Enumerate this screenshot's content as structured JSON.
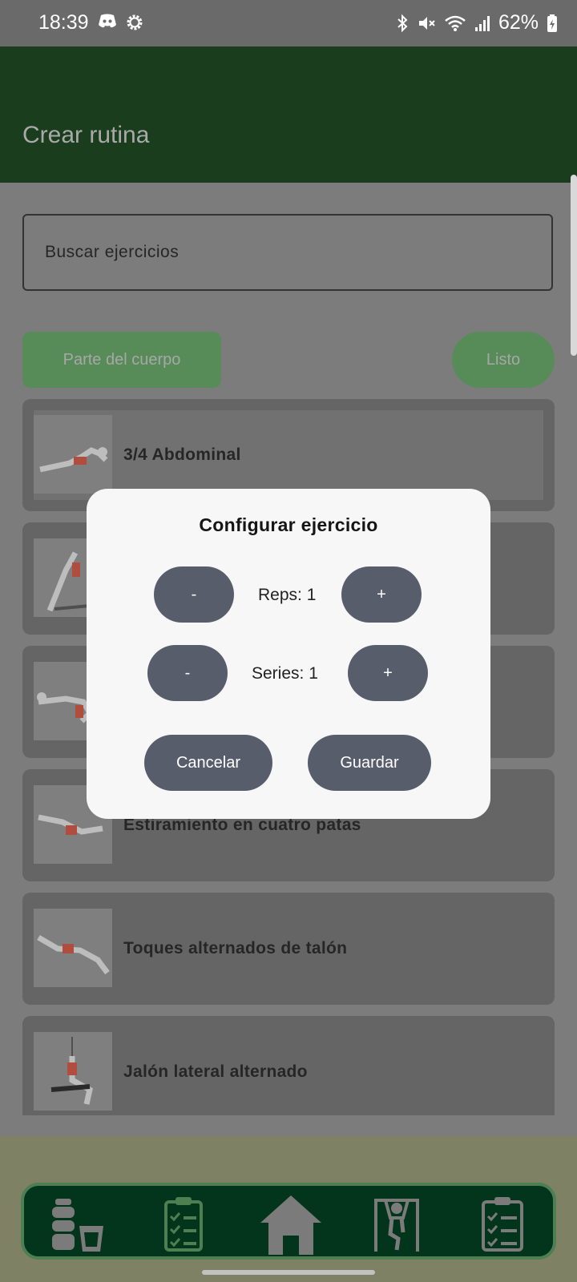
{
  "status_bar": {
    "time": "18:39",
    "battery": "62%",
    "icons_left": [
      "discord-icon",
      "settings-gear-icon"
    ],
    "icons_right": [
      "bluetooth-icon",
      "mute-icon",
      "wifi-icon",
      "signal-icon",
      "battery-icon"
    ]
  },
  "app_bar": {
    "title": "Crear rutina"
  },
  "search": {
    "placeholder": "Buscar ejercicios"
  },
  "filters": {
    "body_part_label": "Parte del cuerpo",
    "done_label": "Listo"
  },
  "exercises": [
    {
      "name": "3/4 Abdominal"
    },
    {
      "name": ""
    },
    {
      "name": ""
    },
    {
      "name": "Estiramiento en cuatro patas"
    },
    {
      "name": "Toques alternados de talón"
    },
    {
      "name": "Jalón lateral alternado"
    }
  ],
  "dialog": {
    "title": "Configurar ejercicio",
    "reps_label": "Reps: 1",
    "series_label": "Series: 1",
    "minus": "-",
    "plus": "+",
    "cancel": "Cancelar",
    "save": "Guardar"
  },
  "bottom_nav": {
    "items": [
      "nutrition-icon",
      "checklist-icon",
      "home-icon",
      "pullup-icon",
      "clipboard-icon"
    ]
  },
  "colors": {
    "app_bar": "#1a3d1d",
    "accent": "#578c59",
    "dialog_button": "#585d6c",
    "nav": "#02351b"
  }
}
